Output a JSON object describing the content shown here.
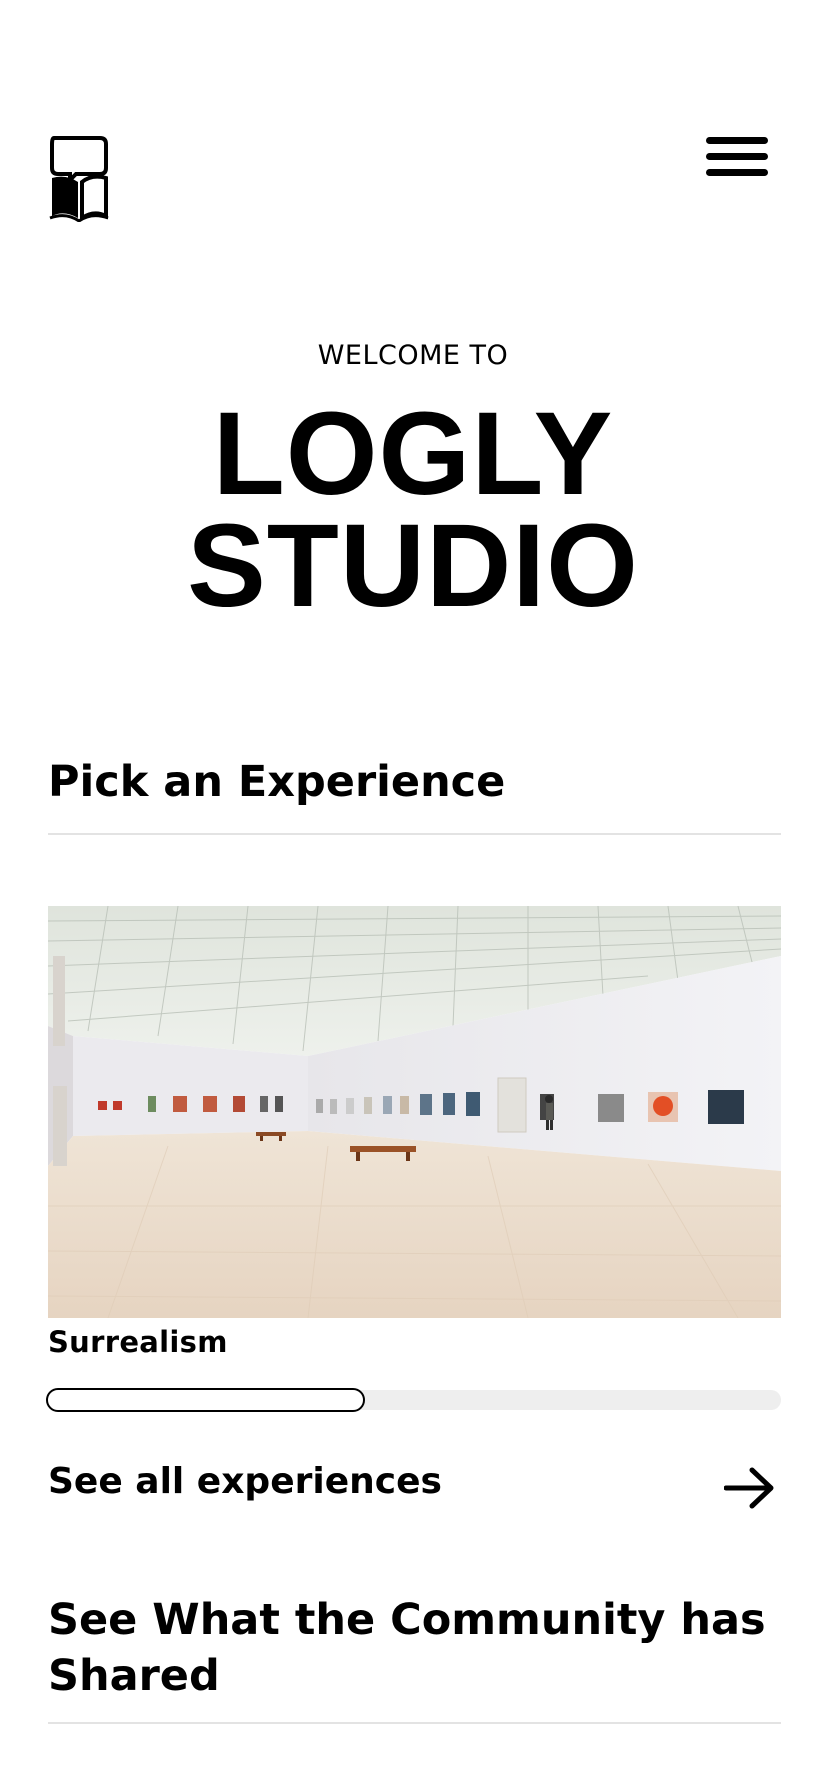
{
  "header": {
    "logo_icon": "book-with-speech-bubble-icon",
    "menu_icon": "hamburger-menu-icon"
  },
  "hero": {
    "welcome": "WELCOME TO",
    "title_line1": "LOGLY",
    "title_line2": "STUDIO"
  },
  "experiences": {
    "heading": "Pick an Experience",
    "items": [
      {
        "name": "Surrealism",
        "image": "art-gallery-photo"
      }
    ],
    "carousel_progress": 0.43,
    "see_all_label": "See all experiences",
    "see_all_icon": "arrow-right-icon"
  },
  "community": {
    "heading": "See What the Community has Shared"
  },
  "colors": {
    "text": "#000000",
    "background": "#ffffff",
    "divider": "#e3e3e3",
    "track": "#eeeeee"
  }
}
